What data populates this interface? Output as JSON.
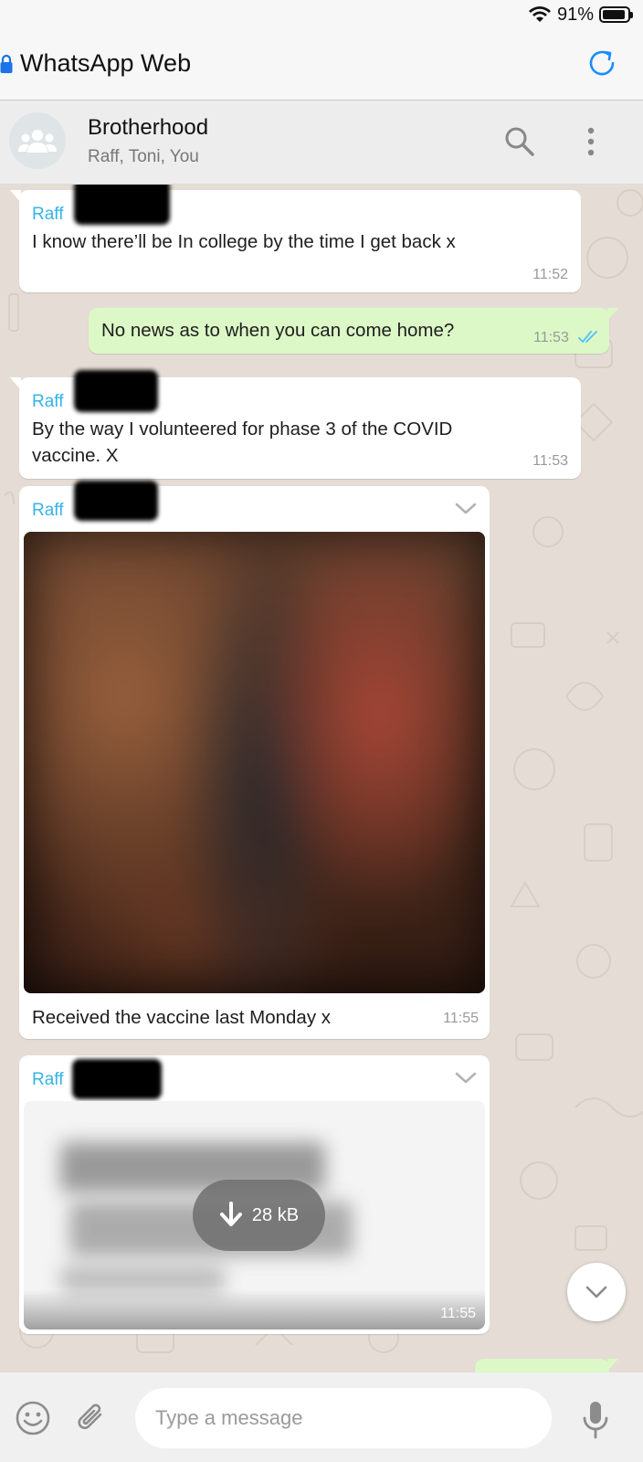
{
  "status_bar": {
    "battery_text": "91%",
    "battery_level": 0.91,
    "icons": [
      "wifi-icon",
      "battery-icon"
    ]
  },
  "browser": {
    "title": "WhatsApp Web",
    "icons": [
      "lock-icon",
      "reload-icon"
    ]
  },
  "chat_header": {
    "name": "Brotherhood",
    "members": "Raff, Toni, You",
    "icons": [
      "group-avatar-icon",
      "search-icon",
      "more-options-icon"
    ]
  },
  "messages": [
    {
      "direction": "incoming",
      "sender": "Raff",
      "text": "I know there’ll be In college by the time I get back x",
      "time": "11:52"
    },
    {
      "direction": "outgoing",
      "text": "No news as to when you can come home?",
      "time": "11:53",
      "status": "read"
    },
    {
      "direction": "incoming",
      "sender": "Raff",
      "text_line1": "By the way I volunteered for phase 3 of the COVID",
      "text_line2": "vaccine. X",
      "time": "11:53"
    },
    {
      "direction": "incoming",
      "type": "image",
      "sender": "Raff",
      "caption": "Received the vaccine last Monday x",
      "time": "11:55"
    },
    {
      "direction": "incoming",
      "type": "document",
      "sender": "Raff",
      "download_size": "28 kB",
      "time": "11:55"
    }
  ],
  "composer": {
    "placeholder": "Type a message",
    "icons": [
      "emoji-icon",
      "attach-icon",
      "microphone-icon"
    ]
  },
  "colors": {
    "incoming_bubble": "#ffffff",
    "outgoing_bubble": "#dcf8c6",
    "sender_name": "#35b3e8",
    "read_ticks": "#4fc3f7",
    "chat_background": "#e5ddd5"
  }
}
